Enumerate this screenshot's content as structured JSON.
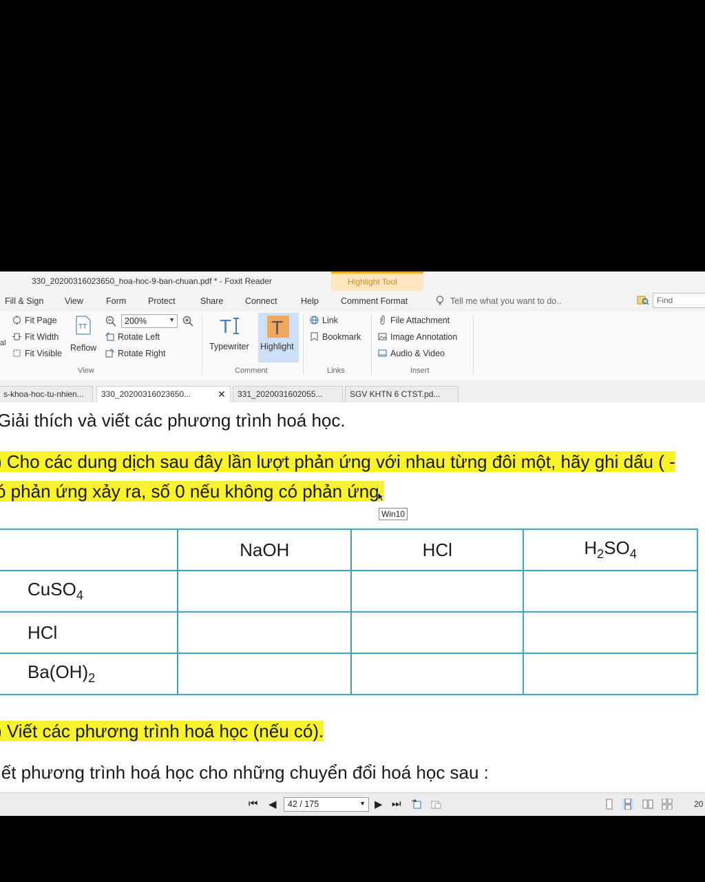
{
  "window": {
    "title": "330_20200316023650_hoa-hoc-9-ban-chuan.pdf * - Foxit Reader",
    "context_tab": "Highlight Tool"
  },
  "menu": {
    "items": [
      "Fill & Sign",
      "View",
      "Form",
      "Protect",
      "Share",
      "Connect",
      "Help",
      "Comment Format"
    ],
    "tell_me": "Tell me what you want to do..",
    "find_placeholder": "Find"
  },
  "ribbon": {
    "fit_page": "Fit Page",
    "fit_width": "Fit Width",
    "fit_visible": "Fit Visible",
    "reflow": "Reflow",
    "zoom_value": "200%",
    "rotate_left": "Rotate Left",
    "rotate_right": "Rotate Right",
    "group_view": "View",
    "typewriter": "Typewriter",
    "highlight": "Highlight",
    "group_comment": "Comment",
    "link": "Link",
    "bookmark": "Bookmark",
    "group_links": "Links",
    "file_attachment": "File Attachment",
    "image_annotation": "Image Annotation",
    "audio_video": "Audio & Video",
    "group_insert": "Insert",
    "left_fragment": "al"
  },
  "tabs": [
    "s-khoa-hoc-tu-nhien...",
    "330_20200316023650...",
    "331_2020031602055...",
    "SGV KHTN 6 CTST.pd..."
  ],
  "document": {
    "line1": "Giải thích và viết các phương trình hoá học.",
    "line2": ") Cho các dung dịch sau đây lần lượt phản ứng với nhau từng đôi một, hãy ghi dấu ( -",
    "line3": "ó phản ứng xảy ra, số 0 nếu không có phản ứng.",
    "tooltip": "Win10",
    "table": {
      "headers": [
        "NaOH",
        "HCl",
        "H",
        "2",
        "SO",
        "4"
      ],
      "rows": [
        {
          "base": "CuSO",
          "sub": "4",
          "after": ""
        },
        {
          "base": "HCl",
          "sub": "",
          "after": ""
        },
        {
          "base": "Ba(OH)",
          "sub": "2",
          "after": ""
        }
      ]
    },
    "line4": ") Viết các phương trình hoá học (nếu có).",
    "line5": "iết phương trình hoá học cho những chuyển đổi hoá học sau :"
  },
  "status": {
    "page_indicator": "42 / 175",
    "zoom_fragment": "20"
  }
}
